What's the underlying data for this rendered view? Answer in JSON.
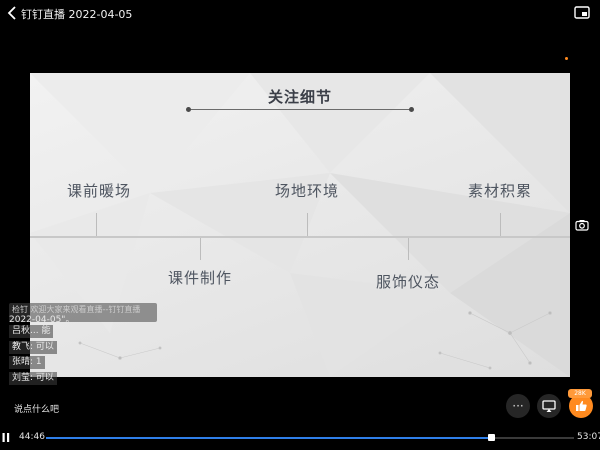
{
  "header": {
    "title": "钉钉直播 2022-04-05"
  },
  "slide": {
    "title": "关注细节",
    "items_top": [
      "课前暖场",
      "场地环境",
      "素材积累"
    ],
    "items_bottom": [
      "课件制作",
      "服饰仪态"
    ]
  },
  "chat": {
    "first_line": "检钉 欢迎大家来观看直播--钉钉直播",
    "first_line_2": "2022-04-05\"。",
    "messages": [
      "吕秋... 能",
      "教飞: 可以",
      "张晴: 1",
      "刘莹: 可以"
    ],
    "input_hint": "说点什么吧"
  },
  "controls": {
    "more_label": "···",
    "like_badge": "28K"
  },
  "playback": {
    "current_time": "44:46",
    "total_time": "53:07",
    "progress": 0.843
  },
  "colors": {
    "accent": "#2f7fe8",
    "like": "#ff8a1f"
  }
}
